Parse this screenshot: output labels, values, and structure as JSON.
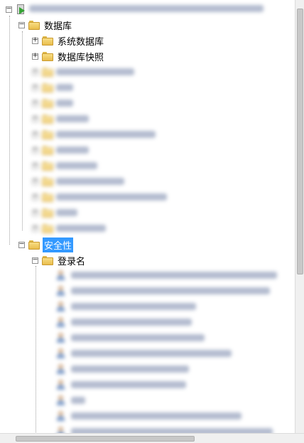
{
  "tree": {
    "databases_label": "数据库",
    "system_databases_label": "系统数据库",
    "snapshots_label": "数据库快照",
    "security_label": "安全性",
    "logins_label": "登录名"
  }
}
